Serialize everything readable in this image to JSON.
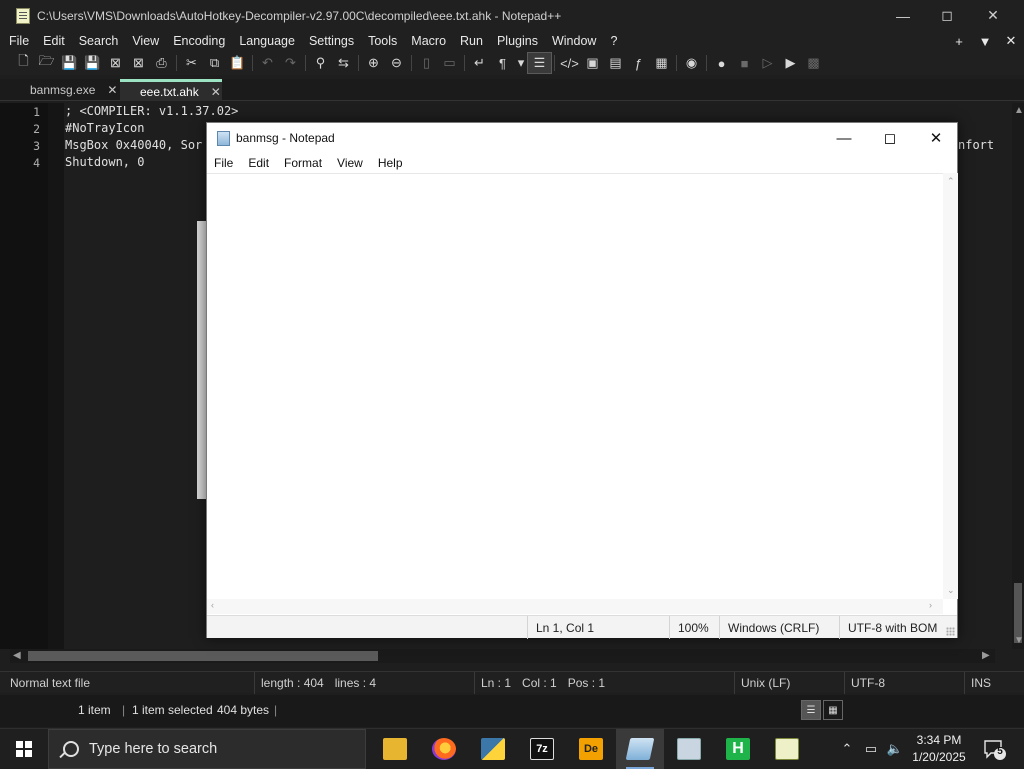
{
  "npp": {
    "title": "C:\\Users\\VMS\\Downloads\\AutoHotkey-Decompiler-v2.97.00C\\decompiled\\eee.txt.ahk - Notepad++",
    "menu": [
      "File",
      "Edit",
      "Search",
      "View",
      "Encoding",
      "Language",
      "Settings",
      "Tools",
      "Macro",
      "Run",
      "Plugins",
      "Window",
      "?"
    ],
    "menu_right": [
      "+",
      "▼",
      "✕"
    ],
    "tabs": [
      {
        "label": "banmsg.exe",
        "active": false
      },
      {
        "label": "eee.txt.ahk",
        "active": true
      }
    ],
    "lines": [
      {
        "num": "1",
        "text": "; <COMPILER: v1.1.37.02>"
      },
      {
        "num": "2",
        "text": "#NoTrayIcon"
      },
      {
        "num": "3",
        "text": "MsgBox 0x40040, Sor"
      },
      {
        "num": "4",
        "text": "Shutdown, 0"
      }
    ],
    "line3_overflow": "nfort",
    "status": {
      "file_type": "Normal text file",
      "length": "length : 404",
      "lines": "lines : 4",
      "ln": "Ln : 1",
      "col": "Col : 1",
      "pos": "Pos : 1",
      "eol": "Unix (LF)",
      "encoding": "UTF-8",
      "mode": "INS"
    }
  },
  "explorer_status": {
    "items": "1 item",
    "selected": "1 item selected",
    "size": "404 bytes"
  },
  "notepad": {
    "title": "banmsg - Notepad",
    "menu": [
      "File",
      "Edit",
      "Format",
      "View",
      "Help"
    ],
    "content": "",
    "status": {
      "position": "Ln 1, Col 1",
      "zoom": "100%",
      "eol": "Windows (CRLF)",
      "encoding": "UTF-8 with BOM"
    }
  },
  "taskbar": {
    "search_placeholder": "Type here to search",
    "apps": [
      {
        "icon": "file-explorer-icon",
        "label": ""
      },
      {
        "icon": "firefox-icon",
        "label": ""
      },
      {
        "icon": "python-icon",
        "label": ""
      },
      {
        "icon": "7zip-icon",
        "label": "7z"
      },
      {
        "icon": "decompiler-icon",
        "label": "De"
      },
      {
        "icon": "notepad-icon",
        "label": ""
      },
      {
        "icon": "remote-desktop-icon",
        "label": ""
      },
      {
        "icon": "hiew-icon",
        "label": "H"
      },
      {
        "icon": "notepadpp-icon",
        "label": ""
      }
    ],
    "time": "3:34 PM",
    "date": "1/20/2025",
    "notification_count": "5"
  },
  "colors": {
    "npp_bg": "#1e1e1e",
    "active_tab_accent": "#9be3c3",
    "taskbar_bg": "#1f1f1f",
    "notepad_bg": "#ffffff"
  }
}
